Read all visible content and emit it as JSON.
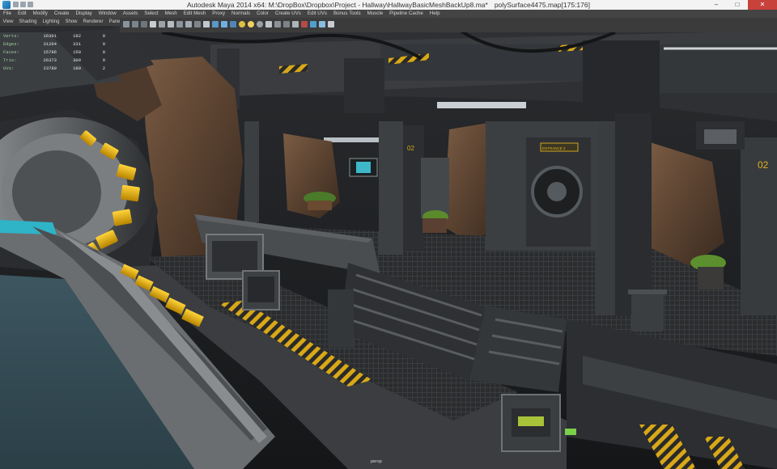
{
  "titlebar": {
    "app_title": "Autodesk Maya 2014 x64: M:\\DropBox\\Dropbox\\Project - Hallway\\HallwayBasicMeshBackUp8.ma*",
    "selection": "polySurface4475.map[175:176]",
    "minimize": "–",
    "maximize": "□",
    "close": "✕"
  },
  "menubar": [
    "File",
    "Edit",
    "Modify",
    "Create",
    "Display",
    "Window",
    "Assets",
    "Select",
    "Mesh",
    "Edit Mesh",
    "Proxy",
    "Normals",
    "Color",
    "Create UVs",
    "Edit UVs",
    "Bonus Tools",
    "Muscle",
    "Pipeline Cache",
    "Help"
  ],
  "panel_menu": [
    "View",
    "Shading",
    "Lighting",
    "Show",
    "Renderer",
    "Panels"
  ],
  "hud": {
    "rows": [
      {
        "label": "Verts:",
        "v1": "16391",
        "v2": "182",
        "v3": "0"
      },
      {
        "label": "Edges:",
        "v1": "31264",
        "v2": "331",
        "v3": "0"
      },
      {
        "label": "Faces:",
        "v1": "15786",
        "v2": "150",
        "v3": "0"
      },
      {
        "label": "Tris:",
        "v1": "26373",
        "v2": "300",
        "v3": "0"
      },
      {
        "label": "UVs:",
        "v1": "23780",
        "v2": "189",
        "v3": "2"
      }
    ]
  },
  "viewport": {
    "camera_label": "persp",
    "signs": {
      "entrance": "ENTRANCE 2",
      "pillar_num": "02",
      "pillar_num_right": "02"
    }
  },
  "colors": {
    "accent_yellow": "#e8b20e",
    "maya_menu": "#444444",
    "maya_title": "#f3f3f3",
    "close_red": "#c8413a"
  }
}
